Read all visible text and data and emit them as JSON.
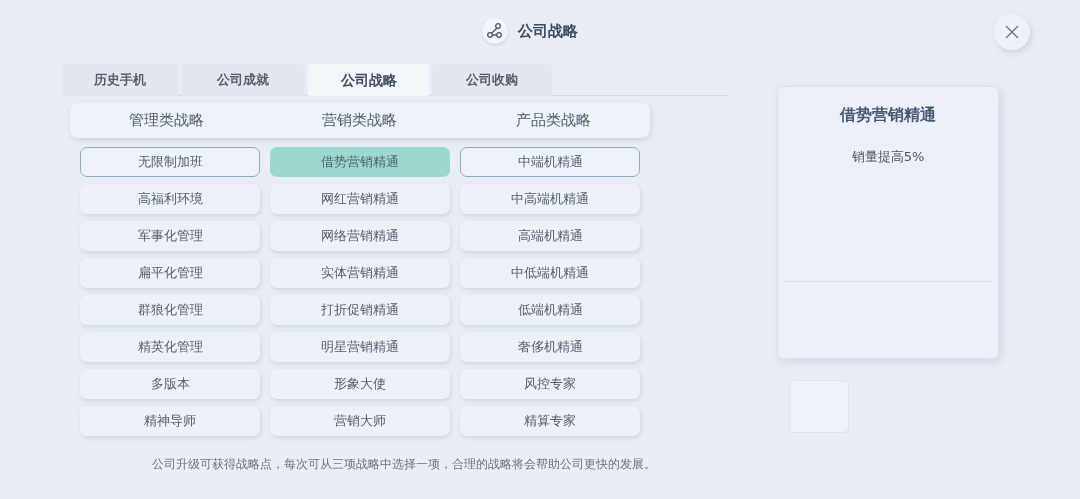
{
  "window": {
    "title": "公司战略"
  },
  "tabs": [
    {
      "label": "历史手机",
      "selected": false
    },
    {
      "label": "公司成就",
      "selected": false
    },
    {
      "label": "公司战略",
      "selected": true
    },
    {
      "label": "公司收购",
      "selected": false
    }
  ],
  "columns": [
    {
      "heading": "管理类战略",
      "items": [
        {
          "label": "无限制加班",
          "chosen": true,
          "selected": false
        },
        {
          "label": "高福利环境",
          "chosen": false,
          "selected": false
        },
        {
          "label": "军事化管理",
          "chosen": false,
          "selected": false
        },
        {
          "label": "扁平化管理",
          "chosen": false,
          "selected": false
        },
        {
          "label": "群狼化管理",
          "chosen": false,
          "selected": false
        },
        {
          "label": "精英化管理",
          "chosen": false,
          "selected": false
        },
        {
          "label": "多版本",
          "chosen": false,
          "selected": false
        },
        {
          "label": "精神导师",
          "chosen": false,
          "selected": false
        }
      ]
    },
    {
      "heading": "营销类战略",
      "items": [
        {
          "label": "借势营销精通",
          "chosen": false,
          "selected": true
        },
        {
          "label": "网红营销精通",
          "chosen": false,
          "selected": false
        },
        {
          "label": "网络营销精通",
          "chosen": false,
          "selected": false
        },
        {
          "label": "实体营销精通",
          "chosen": false,
          "selected": false
        },
        {
          "label": "打折促销精通",
          "chosen": false,
          "selected": false
        },
        {
          "label": "明星营销精通",
          "chosen": false,
          "selected": false
        },
        {
          "label": "形象大使",
          "chosen": false,
          "selected": false
        },
        {
          "label": "营销大师",
          "chosen": false,
          "selected": false
        }
      ]
    },
    {
      "heading": "产品类战略",
      "items": [
        {
          "label": "中端机精通",
          "chosen": true,
          "selected": false
        },
        {
          "label": "中高端机精通",
          "chosen": false,
          "selected": false
        },
        {
          "label": "高端机精通",
          "chosen": false,
          "selected": false
        },
        {
          "label": "中低端机精通",
          "chosen": false,
          "selected": false
        },
        {
          "label": "低端机精通",
          "chosen": false,
          "selected": false
        },
        {
          "label": "奢侈机精通",
          "chosen": false,
          "selected": false
        },
        {
          "label": "风控专家",
          "chosen": false,
          "selected": false
        },
        {
          "label": "精算专家",
          "chosen": false,
          "selected": false
        }
      ]
    }
  ],
  "footer": "公司升级可获得战略点，每次可从三项战略中选择一项，合理的战略将会帮助公司更快的发展。",
  "detail": {
    "title": "借势营销精通",
    "effect": "销量提高5%"
  }
}
